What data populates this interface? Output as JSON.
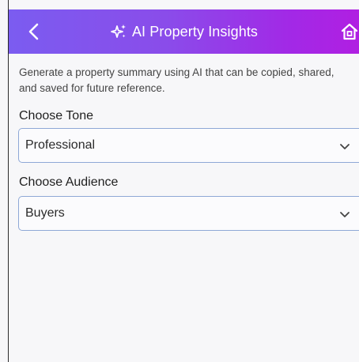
{
  "header": {
    "title": "AI Property Insights",
    "back_icon": "chevron-left-icon",
    "title_icon": "sparkles-icon",
    "home_icon": "home-icon",
    "gradient_start": "#7b5cf0",
    "gradient_end": "#b01fe2"
  },
  "description": "Generate a property summary using AI that can be copied, shared, and saved for future reference.",
  "tone": {
    "label": "Choose Tone",
    "value": "Professional"
  },
  "audience": {
    "label": "Choose Audience",
    "value": "Buyers"
  },
  "colors": {
    "select_border": "#8ea8d6",
    "background": "#f7f7f9"
  }
}
